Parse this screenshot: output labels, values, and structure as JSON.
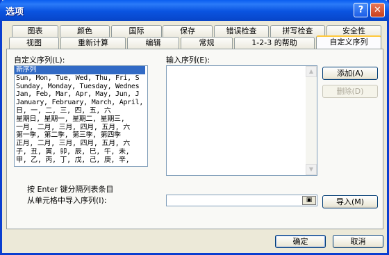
{
  "window": {
    "title": "选项",
    "help_glyph": "?",
    "close_glyph": "✕"
  },
  "tabs_row1": [
    "图表",
    "颜色",
    "国际",
    "保存",
    "错误检查",
    "拼写检查",
    "安全性"
  ],
  "tabs_row2": [
    "视图",
    "重新计算",
    "编辑",
    "常规",
    "1-2-3 的帮助",
    "自定义序列"
  ],
  "active_tab": "自定义序列",
  "custom_lists": {
    "label": "自定义序列(L):",
    "items": [
      "新序列",
      "Sun, Mon, Tue, Wed, Thu, Fri, S",
      "Sunday, Monday, Tuesday, Wednes",
      "Jan, Feb, Mar, Apr, May, Jun, J",
      "January, February, March, April,",
      "日, 一, 二, 三, 四, 五, 六",
      "星期日, 星期一, 星期二, 星期三,",
      "一月, 二月, 三月, 四月, 五月, 六",
      "第一季, 第二季, 第三季, 第四季",
      "正月, 二月, 三月, 四月, 五月, 六",
      "子, 丑, 寅, 卯, 辰, 巳, 午, 未,",
      "甲, 乙, 丙, 丁, 戊, 己, 庚, 辛,"
    ],
    "selected_index": 0
  },
  "input_list": {
    "label": "输入序列(E):",
    "value": ""
  },
  "buttons": {
    "add": "添加(A)",
    "delete": "删除(D)",
    "import": "导入(M)",
    "ok": "确定",
    "cancel": "取消"
  },
  "hint": "按 Enter 键分隔列表条目",
  "import_label": "从单元格中导入序列(I):",
  "import_value": "",
  "ref_glyph": "▣"
}
